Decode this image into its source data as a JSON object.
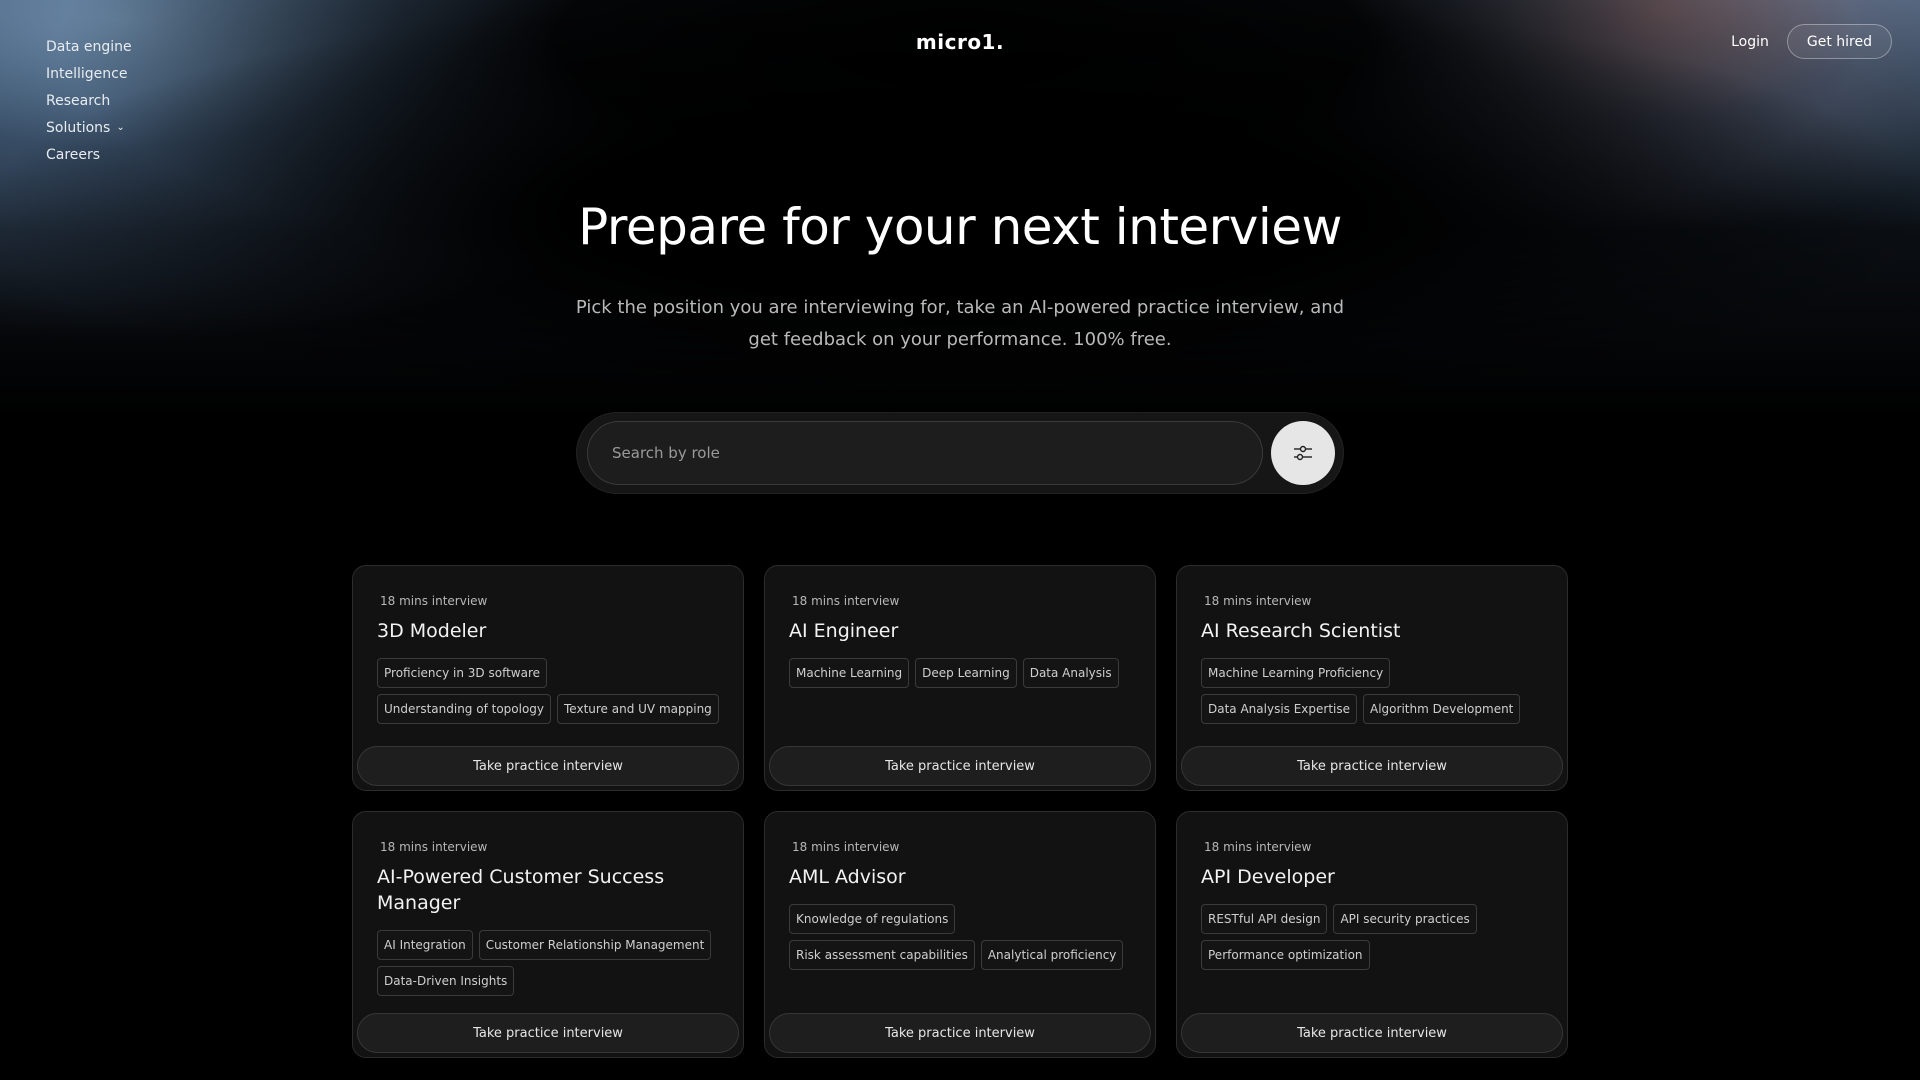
{
  "header": {
    "logo": "micro1.",
    "nav": [
      {
        "label": "Data engine"
      },
      {
        "label": "Intelligence"
      },
      {
        "label": "Research"
      },
      {
        "label": "Solutions",
        "dropdown": true
      },
      {
        "label": "Careers"
      }
    ],
    "login_label": "Login",
    "get_hired_label": "Get hired"
  },
  "hero": {
    "title": "Prepare for your next interview",
    "subtitle_line1": "Pick the position you are interviewing for, take an AI-powered practice interview, and",
    "subtitle_line2": "get feedback on your performance. 100% free."
  },
  "search": {
    "placeholder": "Search by role",
    "value": ""
  },
  "cards": [
    {
      "duration": "18 mins interview",
      "role": "3D Modeler",
      "tags": [
        "Proficiency in 3D software",
        "Understanding of topology",
        "Texture and UV mapping"
      ],
      "cta": "Take practice interview"
    },
    {
      "duration": "18 mins interview",
      "role": "AI Engineer",
      "tags": [
        "Machine Learning",
        "Deep Learning",
        "Data Analysis"
      ],
      "cta": "Take practice interview"
    },
    {
      "duration": "18 mins interview",
      "role": "AI Research Scientist",
      "tags": [
        "Machine Learning Proficiency",
        "Data Analysis Expertise",
        "Algorithm Development"
      ],
      "cta": "Take practice interview"
    },
    {
      "duration": "18 mins interview",
      "role": "AI-Powered Customer Success Manager",
      "tags": [
        "AI Integration",
        "Customer Relationship Management",
        "Data-Driven Insights"
      ],
      "cta": "Take practice interview"
    },
    {
      "duration": "18 mins interview",
      "role": "AML Advisor",
      "tags": [
        "Knowledge of regulations",
        "Risk assessment capabilities",
        "Analytical proficiency"
      ],
      "cta": "Take practice interview"
    },
    {
      "duration": "18 mins interview",
      "role": "API Developer",
      "tags": [
        "RESTful API design",
        "API security practices",
        "Performance optimization"
      ],
      "cta": "Take practice interview"
    }
  ]
}
